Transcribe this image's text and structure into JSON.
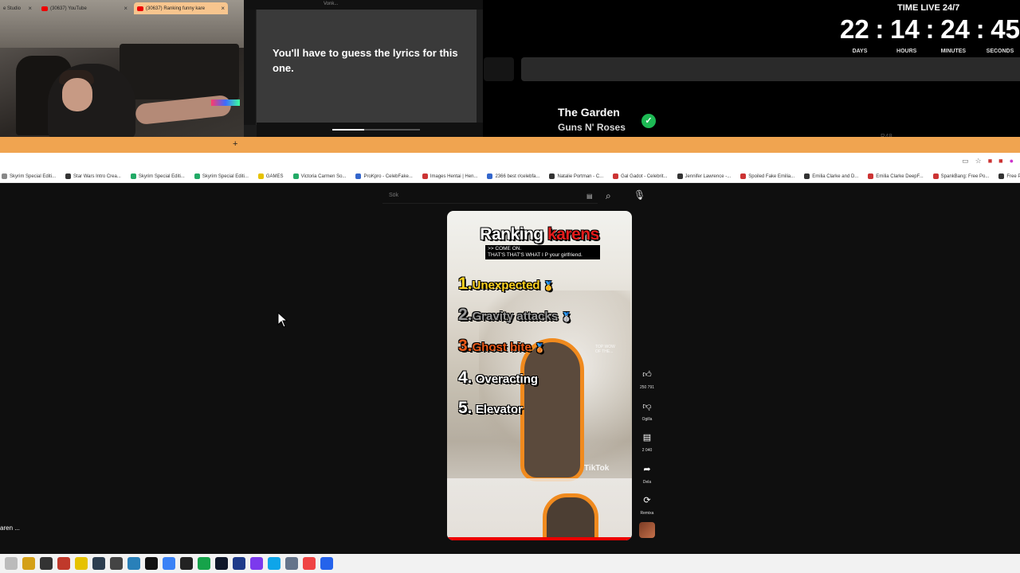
{
  "overlay": {
    "lyrics_prompt": "You'll have to guess the lyrics for this one.",
    "lyrics_window_title": "Vonk...",
    "timer": {
      "title": "TIME LIVE 24/7",
      "days": "22",
      "hours": "14",
      "minutes": "24",
      "seconds": "45",
      "labels": [
        "DAYS",
        "HOURS",
        "MINUTES",
        "SECONDS"
      ]
    },
    "song": {
      "title": "The Garden",
      "artist": "Guns N' Roses"
    },
    "faded_text": "R48.."
  },
  "browser": {
    "tabs": [
      {
        "label": "e Studio"
      },
      {
        "label": "(30637) YouTube"
      },
      {
        "label": "(30637) Ranking funny kare"
      }
    ],
    "bookmarks": [
      "Skyrim Special Editi...",
      "Star Wars Intro Crea...",
      "Skyrim Special Editi...",
      "Skyrim Special Editi...",
      "GAMES",
      "Victoria Carmen So...",
      "ProKpro - CelebFake...",
      "Images Hentai | Hen...",
      "2366 best r/celebfa...",
      "Natalie Portman - C...",
      "Gal Gadot - Celebrit...",
      "Jennifer Lawrence -...",
      "Spoiled Fake Emilia...",
      "Emilia Clarke and D...",
      "Emilia Clarke DeepF...",
      "SpankBang: Free Po...",
      "Free Porn Videos C..."
    ]
  },
  "youtube": {
    "search_placeholder": "Sök",
    "video": {
      "title_white": "Ranking ",
      "title_red": "karens",
      "caption": ">> COME ON.\nTHAT'S THAT'S WHAT I P your girlfriend.",
      "ranks": [
        {
          "n": "1.",
          "label": "Unexpected",
          "emoji": "🥇"
        },
        {
          "n": "2.",
          "label": "Gravity attacks",
          "emoji": "🥈"
        },
        {
          "n": "3.",
          "label": "Ghost bite",
          "emoji": "🥉"
        },
        {
          "n": "4.",
          "label": "Overacting",
          "emoji": ""
        },
        {
          "n": "5.",
          "label": "Elevator",
          "emoji": ""
        }
      ],
      "watermark": "TikTok",
      "tag": "TOP WOW OF THE..."
    },
    "actions": {
      "like_count": "250 791",
      "dislike_label": "Ogilla",
      "comments_count": "2 040",
      "share_label": "Dela",
      "remix_label": "Remixa"
    },
    "sidebar_hint": "aren ..."
  },
  "colors": {
    "tabbar": "#f0a450",
    "check_green": "#1db954",
    "title_red": "#e31b1b",
    "outline_orange": "#f08a1e"
  }
}
